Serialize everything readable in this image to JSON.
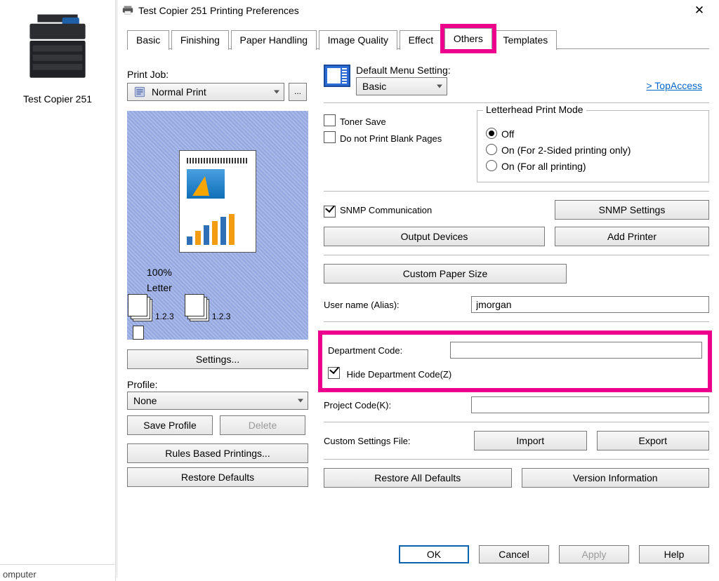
{
  "leftcol": {
    "device_label": "Test Copier 251",
    "footer": "omputer"
  },
  "window": {
    "title": "Test Copier 251 Printing Preferences"
  },
  "tabs": [
    "Basic",
    "Finishing",
    "Paper Handling",
    "Image Quality",
    "Effect",
    "Others",
    "Templates"
  ],
  "printjob": {
    "label": "Print Job:",
    "selected": "Normal Print",
    "preview_percent": "100%",
    "preview_paper": "Letter",
    "stack_label1": "1.2.3",
    "stack_label2": "1.2.3",
    "settings_btn": "Settings...",
    "profile_label": "Profile:",
    "profile_selected": "None",
    "save_profile": "Save Profile",
    "delete_profile": "Delete",
    "rules_btn": "Rules Based Printings...",
    "restore_btn": "Restore Defaults"
  },
  "right": {
    "default_menu_label": "Default Menu Setting:",
    "default_menu_value": "Basic",
    "topaccess": "> TopAccess",
    "toner_save": "Toner Save",
    "blank_pages": "Do not Print Blank Pages",
    "lph": {
      "legend": "Letterhead Print Mode",
      "off": "Off",
      "on2": "On (For 2-Sided printing only)",
      "onall": "On (For all printing)"
    },
    "snmp_chk": "SNMP Communication",
    "snmp_btn": "SNMP Settings",
    "output_devices": "Output Devices",
    "add_printer": "Add Printer",
    "custom_paper": "Custom Paper Size",
    "username_label": "User name (Alias):",
    "username_value": "jmorgan",
    "dept_label": "Department Code:",
    "dept_value": "",
    "hide_dept": "Hide Department Code(Z)",
    "project_label": "Project Code(K):",
    "project_value": "",
    "custom_settings_label": "Custom Settings File:",
    "import": "Import",
    "export": "Export",
    "restore_all": "Restore All Defaults",
    "version_info": "Version Information"
  },
  "buttons": {
    "ok": "OK",
    "cancel": "Cancel",
    "apply": "Apply",
    "help": "Help"
  }
}
